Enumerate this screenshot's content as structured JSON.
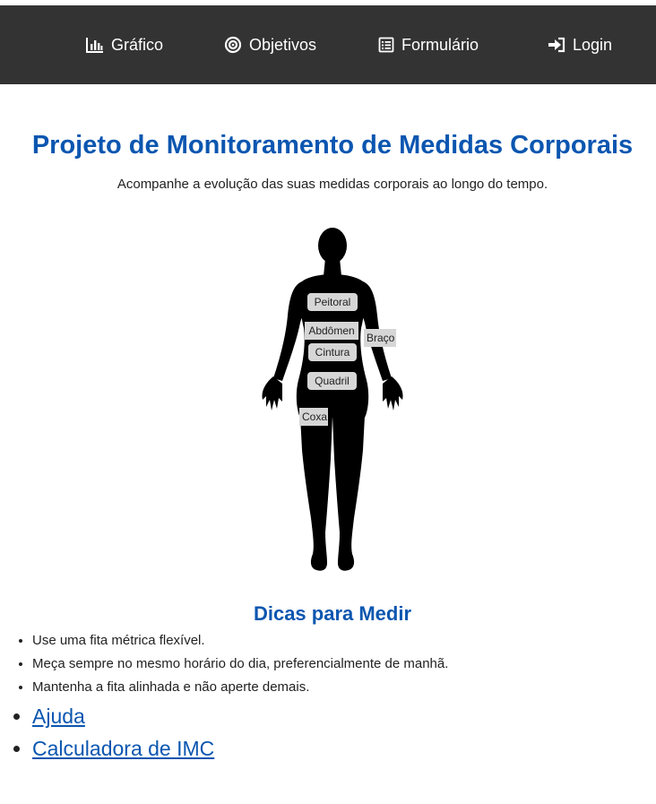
{
  "nav": {
    "items": [
      {
        "label": "Gráfico",
        "icon": "bar-chart-icon"
      },
      {
        "label": "Objetivos",
        "icon": "target-icon"
      },
      {
        "label": "Formulário",
        "icon": "form-icon"
      },
      {
        "label": "Login",
        "icon": "login-icon"
      }
    ],
    "background": "#333333",
    "text_color": "#ffffff"
  },
  "header": {
    "title": "Projeto de Monitoramento de Medidas Corporais",
    "subtitle": "Acompanhe a evolução das suas medidas corporais ao longo do tempo."
  },
  "body_map": {
    "labels": {
      "peitoral": "Peitoral",
      "abdomen": "Abdômen",
      "braco": "Braço",
      "cintura": "Cintura",
      "quadril": "Quadril",
      "coxa": "Coxa"
    },
    "label_background": "#d6d6d6",
    "figure_color": "#000000"
  },
  "tips": {
    "title": "Dicas para Medir",
    "items": [
      "Use uma fita métrica flexível.",
      "Meça sempre no mesmo horário do dia, preferencialmente de manhã.",
      "Mantenha a fita alinhada e não aperte demais."
    ]
  },
  "links": [
    "Ajuda",
    "Calculadora de IMC"
  ],
  "colors": {
    "accent": "#0b56b0"
  }
}
